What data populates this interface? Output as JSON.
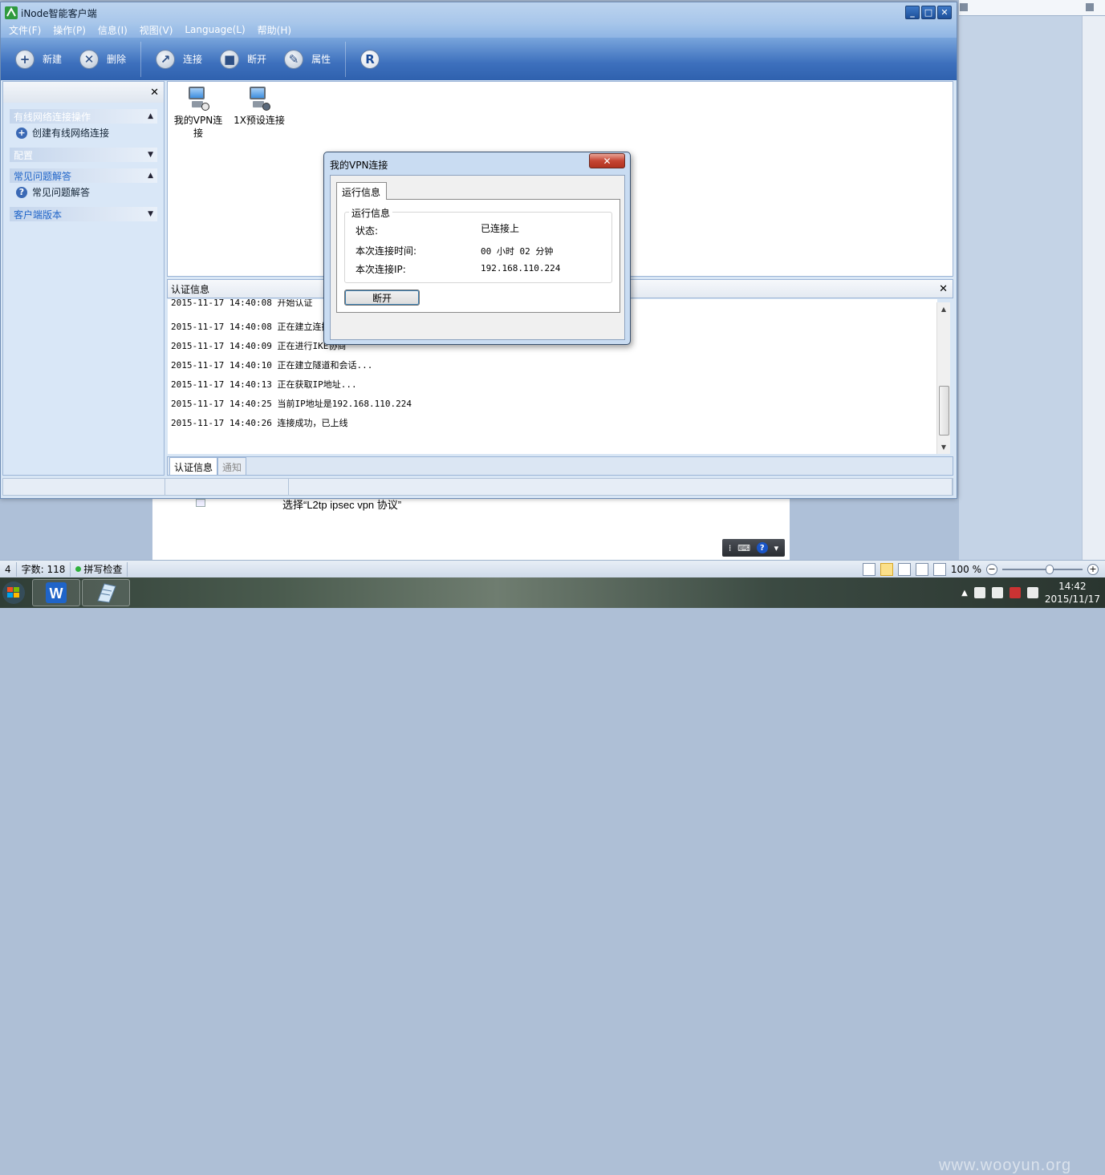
{
  "background_doc": {
    "page_text": "选择“L2tp ipsec vpn 协议”",
    "status": {
      "page_index": "4",
      "word_count": "字数: 118",
      "spellcheck": "拼写检查",
      "zoom": "100 %"
    }
  },
  "taskbar": {
    "watermark": "www.wooyun.org",
    "clock_time": "14:42",
    "clock_date": "2015/11/17",
    "apps": [
      "wps-writer",
      "document"
    ]
  },
  "window": {
    "title": "iNode智能客户端",
    "controls": {
      "minimize": "_",
      "maximize": "□",
      "close": "✕"
    },
    "menu": [
      "文件(F)",
      "操作(P)",
      "信息(I)",
      "视图(V)",
      "Language(L)",
      "帮助(H)"
    ],
    "toolbar": {
      "new": "新建",
      "delete": "删除",
      "connect": "连接",
      "disconnect": "断开",
      "properties": "属性"
    },
    "sidebar": {
      "close": "✕",
      "sections": [
        {
          "title": "有线网络连接操作",
          "caret": "▲",
          "item": "创建有线网络连接"
        },
        {
          "title": "配置",
          "caret": "▼"
        },
        {
          "title": "常见问题解答",
          "caret": "▲",
          "item": "常见问题解答"
        },
        {
          "title": "客户端版本",
          "caret": "▼"
        }
      ]
    },
    "connections": [
      {
        "label_line1": "我的VPN连",
        "label_line2": "接"
      },
      {
        "label_line1": "1X预设连接",
        "label_line2": ""
      }
    ],
    "auth": {
      "title": "认证信息",
      "close": "✕",
      "log": [
        "2015-11-17 14:40:08 开始认证",
        "2015-11-17 14:40:08 正在建立连接",
        "2015-11-17 14:40:09 正在进行IKE协商",
        "2015-11-17 14:40:10 正在建立隧道和会话...",
        "2015-11-17 14:40:13 正在获取IP地址...",
        "2015-11-17 14:40:25 当前IP地址是192.168.110.224",
        "2015-11-17 14:40:26 连接成功，已上线"
      ],
      "tabs": [
        "认证信息",
        "通知"
      ]
    }
  },
  "dialog": {
    "title": "我的VPN连接",
    "close": "✕",
    "tab": "运行信息",
    "group_title": "运行信息",
    "rows": [
      {
        "key": "状态:",
        "value": "已连接上"
      },
      {
        "key": "本次连接时间:",
        "value": "00 小时 02 分钟"
      },
      {
        "key": "本次连接IP:",
        "value": "192.168.110.224"
      }
    ],
    "disconnect_button": "断开"
  }
}
